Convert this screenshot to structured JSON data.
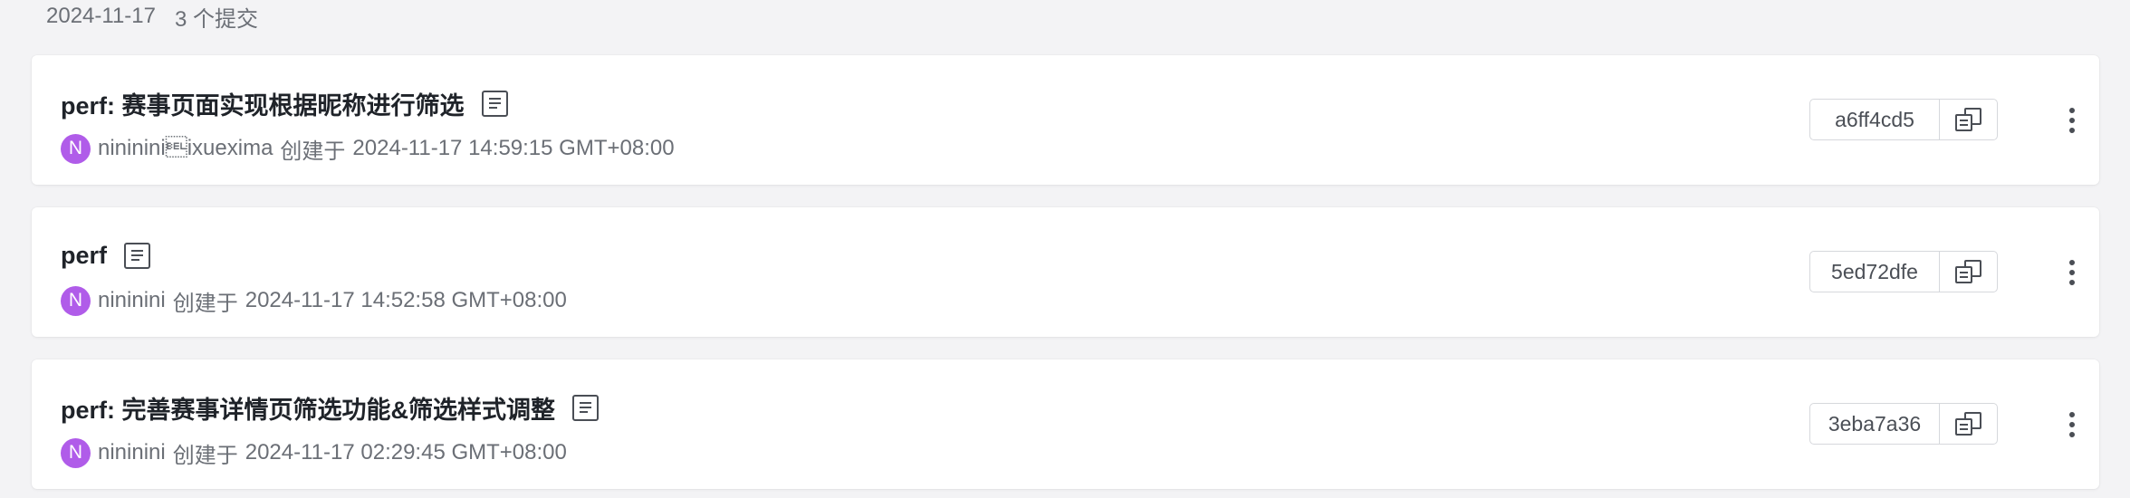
{
  "group": {
    "date": "2024-11-17",
    "count_label": "3 个提交"
  },
  "commits": [
    {
      "title": "perf: 赛事页面实现根据昵称进行筛选",
      "avatar_letter": "N",
      "author": "nininini\u0007ixueximа",
      "created_label": "创建于",
      "created_at": "2024-11-17 14:59:15 GMT+08:00",
      "sha": "a6ff4cd5"
    },
    {
      "title": "perf",
      "avatar_letter": "N",
      "author": "nininini",
      "created_label": "创建于",
      "created_at": "2024-11-17 14:52:58 GMT+08:00",
      "sha": "5ed72dfe"
    },
    {
      "title": "perf: 完善赛事详情页筛选功能&筛选样式调整",
      "avatar_letter": "N",
      "author": "nininini",
      "created_label": "创建于",
      "created_at": "2024-11-17 02:29:45 GMT+08:00",
      "sha": "3eba7a36"
    }
  ],
  "icons": {
    "message": "commit-message-icon",
    "copy": "copy-icon",
    "more": "more-vertical-icon"
  },
  "colors": {
    "avatar": "#b05ce9",
    "page_background": "#f3f3f5",
    "card_background": "#ffffff"
  }
}
